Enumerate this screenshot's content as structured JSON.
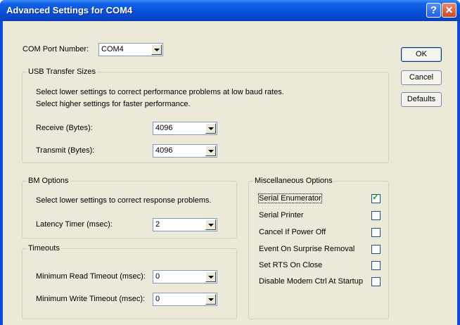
{
  "window": {
    "title": "Advanced Settings for COM4",
    "help_glyph": "?",
    "close_glyph": "✕"
  },
  "com_port": {
    "label": "COM Port Number:",
    "value": "COM4"
  },
  "usb": {
    "title": "USB Transfer Sizes",
    "desc1": "Select lower settings to correct performance problems at low baud rates.",
    "desc2": "Select higher settings for faster performance.",
    "receive_label": "Receive (Bytes):",
    "receive_value": "4096",
    "transmit_label": "Transmit (Bytes):",
    "transmit_value": "4096"
  },
  "bm": {
    "title": "BM Options",
    "desc": "Select lower settings to correct response problems.",
    "latency_label": "Latency Timer (msec):",
    "latency_value": "2"
  },
  "timeouts": {
    "title": "Timeouts",
    "read_label": "Minimum Read Timeout (msec):",
    "read_value": "0",
    "write_label": "Minimum Write Timeout (msec):",
    "write_value": "0"
  },
  "misc": {
    "title": "Miscellaneous Options",
    "options": [
      {
        "label": "Serial Enumerator",
        "checked": true
      },
      {
        "label": "Serial Printer",
        "checked": false
      },
      {
        "label": "Cancel If Power Off",
        "checked": false
      },
      {
        "label": "Event On Surprise Removal",
        "checked": false
      },
      {
        "label": "Set RTS On Close",
        "checked": false
      },
      {
        "label": "Disable Modem Ctrl At Startup",
        "checked": false
      }
    ],
    "check_glyph": "✓"
  },
  "buttons": {
    "ok": "OK",
    "cancel": "Cancel",
    "defaults": "Defaults"
  }
}
